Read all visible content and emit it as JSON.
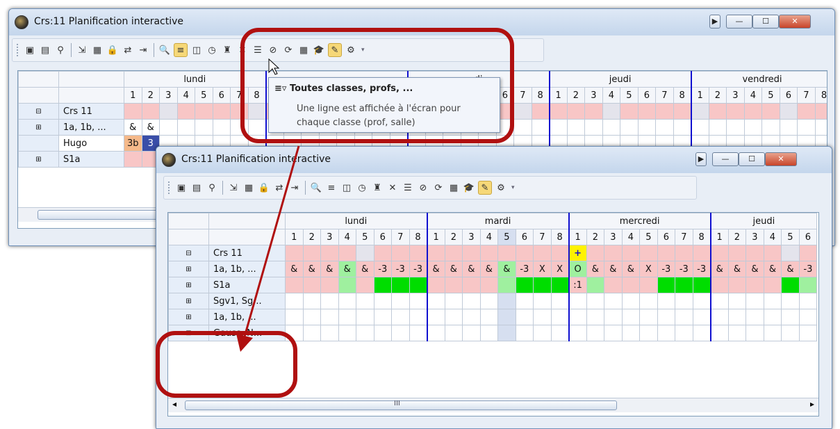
{
  "window_title": "Crs:11  Planification interactive",
  "title_buttons": {
    "arrow": "▶",
    "minimize": "—",
    "maximize": "☐",
    "close": "✕"
  },
  "toolbar_icons": [
    "window-add-icon",
    "window-remove-icon",
    "pin-icon",
    "export-icon",
    "lock-add-icon",
    "lock-icon",
    "swap-icon",
    "move-icon",
    "magnify-icon",
    "list-filter-icon",
    "rooms-icon",
    "clock-icon",
    "teacher-icon",
    "delete-lesson-icon",
    "lines-icon",
    "remove-icon",
    "refresh-icon",
    "calculator-icon",
    "graduation-cap-icon",
    "palette-icon",
    "settings-gear-icon"
  ],
  "tooltip": {
    "title": "Toutes classes, profs, ...",
    "line1": "Une ligne est affichée à l'écran pour",
    "line2": "chaque classe (prof, salle)"
  },
  "back_window": {
    "days": [
      "lundi",
      "jeudi",
      "vendredi"
    ],
    "day_fragment": "di",
    "rows": [
      {
        "ctl": "⊟",
        "label": "Crs 11"
      },
      {
        "ctl": "⊞",
        "label": "1a, 1b, ..."
      },
      {
        "ctl": "",
        "label": "Hugo"
      },
      {
        "ctl": "⊞",
        "label": "S1a"
      }
    ],
    "row2_cells": [
      "&",
      "&"
    ],
    "row3_cells": [
      "3b",
      "3"
    ]
  },
  "front_window": {
    "days": [
      "lundi",
      "mardi",
      "mercredi",
      "jeudi"
    ],
    "periods": [
      "1",
      "2",
      "3",
      "4",
      "5",
      "6",
      "7",
      "8"
    ],
    "rows": [
      {
        "ctl": "⊟",
        "label": "Crs 11"
      },
      {
        "ctl": "⊞",
        "label": "1a, 1b, ..."
      },
      {
        "ctl": "⊞",
        "label": "S1a"
      },
      {
        "ctl": "⊞",
        "label": "Sgv1, Sg..."
      },
      {
        "ctl": "⊞",
        "label": "1a, 1b, ..."
      },
      {
        "ctl": "⊞",
        "label": "Gauss, N..."
      }
    ],
    "row2_cells": [
      "&",
      "&",
      "&",
      "&",
      "&",
      "-3",
      "-3",
      "-3",
      "&",
      "&",
      "&",
      "&",
      "&",
      "-3",
      "X",
      "X",
      "O",
      "&",
      "&",
      "&",
      "X",
      "-3",
      "-3",
      "-3",
      "&",
      "&",
      "&",
      "&",
      "&",
      "-3"
    ],
    "plus_mark": "+",
    "s1a_mark": ":1",
    "scroll_label": "III",
    "scroll_left": "◂",
    "scroll_right": "▸"
  },
  "colors": {
    "annotation": "#b01010",
    "conflict_pink": "#f8c6c6",
    "free_green": "#00dd00",
    "day_divider": "#1010d0"
  }
}
